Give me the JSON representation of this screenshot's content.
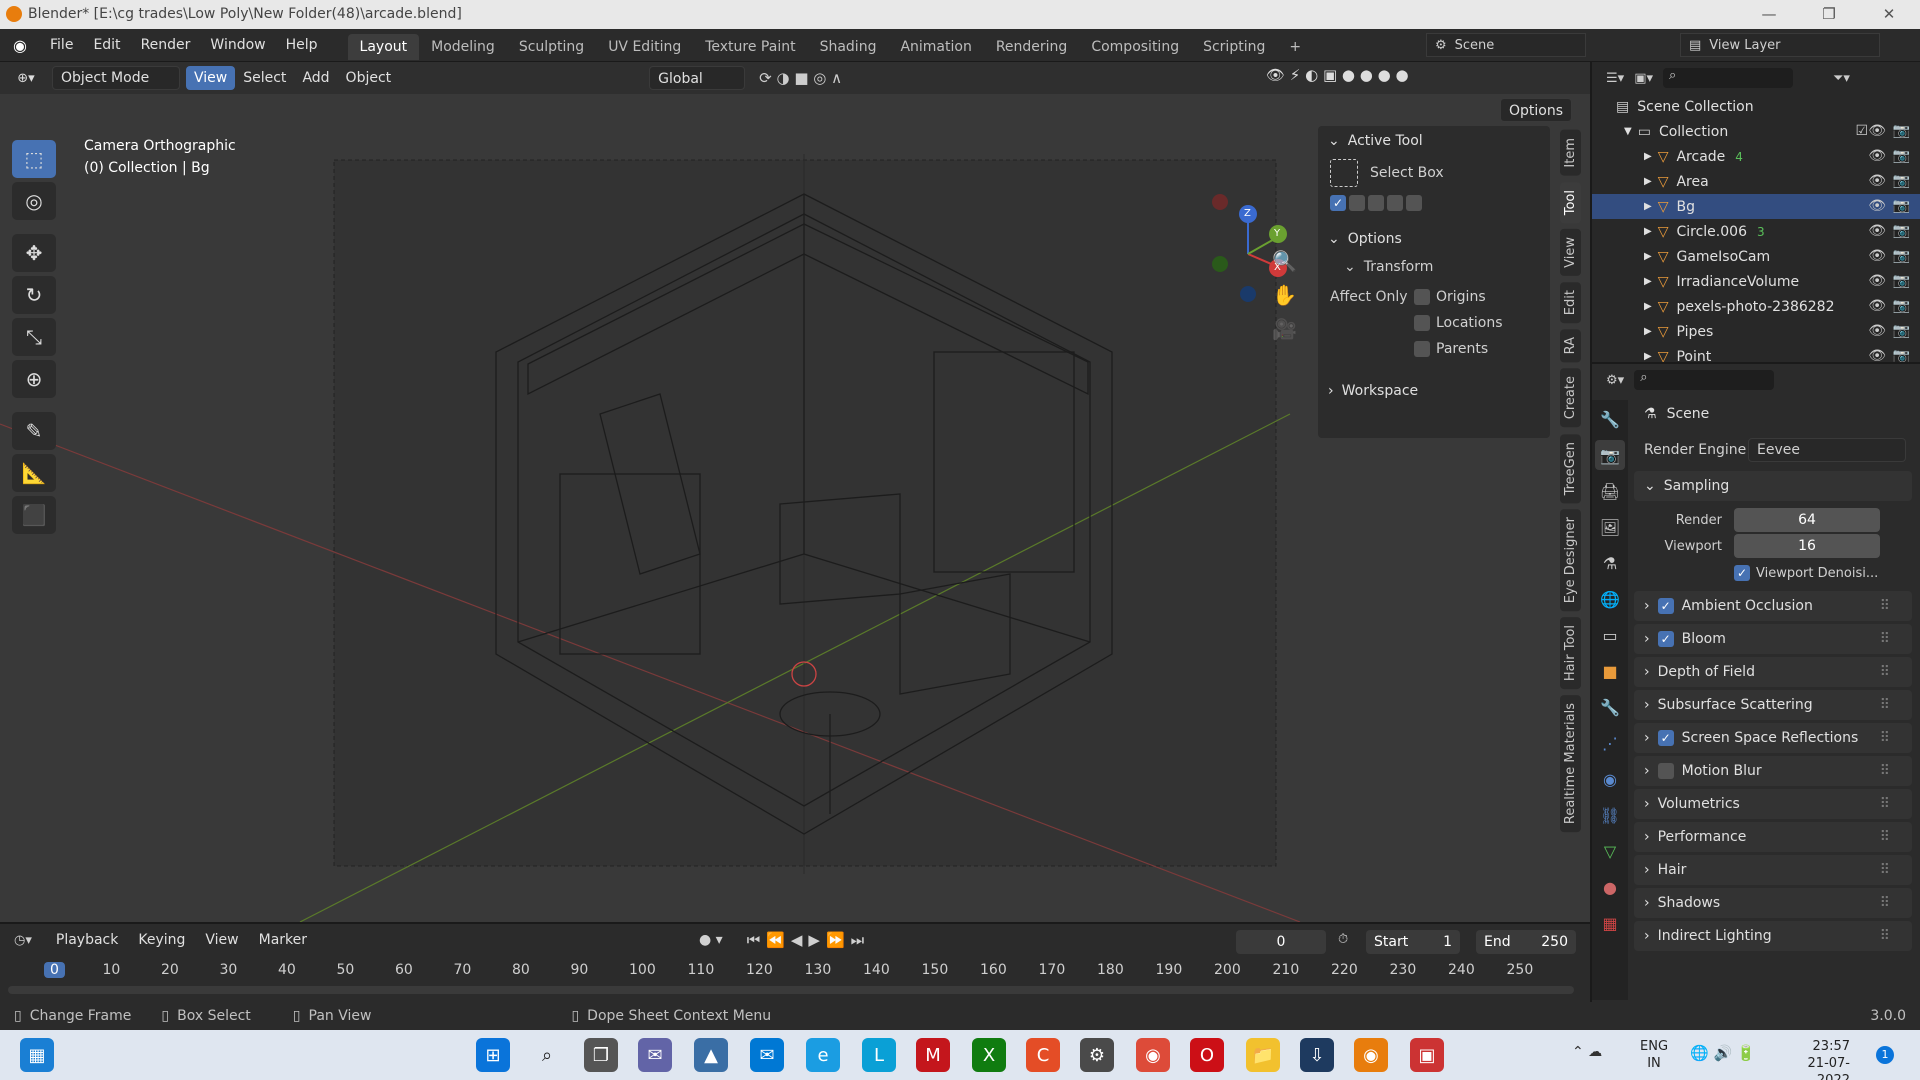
{
  "window": {
    "title": "Blender* [E:\\cg trades\\Low Poly\\New Folder(48)\\arcade.blend]",
    "minimize": "—",
    "maximize": "❐",
    "close": "✕"
  },
  "menu": [
    "File",
    "Edit",
    "Render",
    "Window",
    "Help"
  ],
  "workspaces": [
    "Layout",
    "Modeling",
    "Sculpting",
    "UV Editing",
    "Texture Paint",
    "Shading",
    "Animation",
    "Rendering",
    "Compositing",
    "Scripting",
    "+"
  ],
  "scene_name": "Scene",
  "view_layer": "View Layer",
  "viewport_header": {
    "mode": "Object Mode",
    "view": "View",
    "select": "Select",
    "add": "Add",
    "object": "Object",
    "orientation": "Global",
    "options": "Options"
  },
  "viewport": {
    "camera_label": "Camera Orthographic",
    "collection_label": "(0) Collection | Bg",
    "gizmo_x": "X",
    "gizmo_y": "Y",
    "gizmo_z": "Z"
  },
  "npanel": {
    "active_tool_title": "Active Tool",
    "tool_name": "Select Box",
    "options_title": "Options",
    "transform_title": "Transform",
    "affect_only": "Affect Only",
    "origins": "Origins",
    "locations": "Locations",
    "parents": "Parents",
    "workspace_title": "Workspace"
  },
  "side_tabs": [
    "Item",
    "Tool",
    "View",
    "Edit",
    "RA",
    "Create",
    "TreeGen",
    "Eye Designer",
    "Hair Tool",
    "Realtime Materials"
  ],
  "outliner": {
    "scene_collection": "Scene Collection",
    "collection": "Collection",
    "items": [
      {
        "name": "Arcade",
        "badge": "4"
      },
      {
        "name": "Area",
        "badge": ""
      },
      {
        "name": "Bg",
        "badge": ""
      },
      {
        "name": "Circle.006",
        "badge": "3"
      },
      {
        "name": "GameIsoCam",
        "badge": ""
      },
      {
        "name": "IrradianceVolume",
        "badge": ""
      },
      {
        "name": "pexels-photo-2386282",
        "badge": ""
      },
      {
        "name": "Pipes",
        "badge": ""
      },
      {
        "name": "Point",
        "badge": ""
      }
    ]
  },
  "properties": {
    "scene": "Scene",
    "render_engine_label": "Render Engine",
    "render_engine": "Eevee",
    "sampling": "Sampling",
    "render_label": "Render",
    "render_value": "64",
    "viewport_label": "Viewport",
    "viewport_value": "16",
    "viewport_denoise": "Viewport Denoisi...",
    "panels": [
      {
        "label": "Ambient Occlusion",
        "checkbox": true
      },
      {
        "label": "Bloom",
        "checkbox": true
      },
      {
        "label": "Depth of Field",
        "checkbox": null
      },
      {
        "label": "Subsurface Scattering",
        "checkbox": null
      },
      {
        "label": "Screen Space Reflections",
        "checkbox": true
      },
      {
        "label": "Motion Blur",
        "checkbox": false
      },
      {
        "label": "Volumetrics",
        "checkbox": null
      },
      {
        "label": "Performance",
        "checkbox": null
      },
      {
        "label": "Hair",
        "checkbox": null
      },
      {
        "label": "Shadows",
        "checkbox": null
      },
      {
        "label": "Indirect Lighting",
        "checkbox": null
      }
    ]
  },
  "timeline": {
    "playback": "Playback",
    "keying": "Keying",
    "view": "View",
    "marker": "Marker",
    "current_frame": "0",
    "start_label": "Start",
    "start": "1",
    "end_label": "End",
    "end": "250",
    "ticks": [
      "0",
      "10",
      "20",
      "30",
      "40",
      "50",
      "60",
      "70",
      "80",
      "90",
      "100",
      "110",
      "120",
      "130",
      "140",
      "150",
      "160",
      "170",
      "180",
      "190",
      "200",
      "210",
      "220",
      "230",
      "240",
      "250"
    ]
  },
  "statusbar": {
    "change_frame": "Change Frame",
    "box_select": "Box Select",
    "pan_view": "Pan View",
    "context_menu": "Dope Sheet Context Menu",
    "version": "3.0.0"
  },
  "taskbar": {
    "lang1": "ENG",
    "lang2": "IN",
    "time": "23:57",
    "date": "21-07-2022",
    "notif": "1"
  },
  "colors": {
    "accent": "#4772b3",
    "selected_row": "#334d80",
    "blender_orange": "#e87d0d"
  }
}
